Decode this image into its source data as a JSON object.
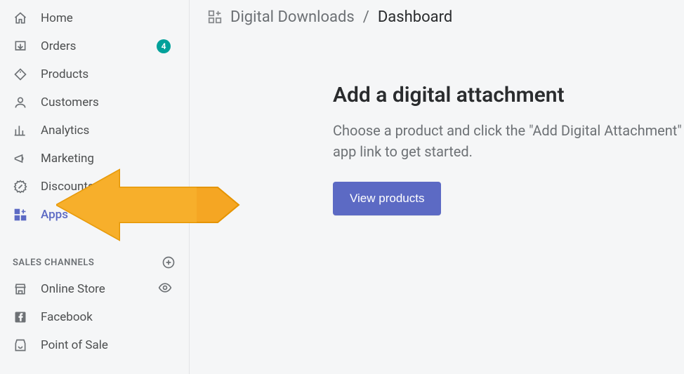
{
  "sidebar": {
    "items": [
      {
        "label": "Home"
      },
      {
        "label": "Orders",
        "badge": "4"
      },
      {
        "label": "Products"
      },
      {
        "label": "Customers"
      },
      {
        "label": "Analytics"
      },
      {
        "label": "Marketing"
      },
      {
        "label": "Discounts"
      },
      {
        "label": "Apps"
      }
    ],
    "section_label": "SALES CHANNELS",
    "channels": [
      {
        "label": "Online Store"
      },
      {
        "label": "Facebook"
      },
      {
        "label": "Point of Sale"
      }
    ]
  },
  "breadcrumb": {
    "app": "Digital Downloads",
    "separator": "/",
    "current": "Dashboard"
  },
  "content": {
    "heading": "Add a digital attachment",
    "body": "Choose a product and click the \"Add Digital Attachment\" app link to get started.",
    "cta": "View products"
  },
  "colors": {
    "accent": "#5c6ac4",
    "badge": "#00a19a"
  }
}
